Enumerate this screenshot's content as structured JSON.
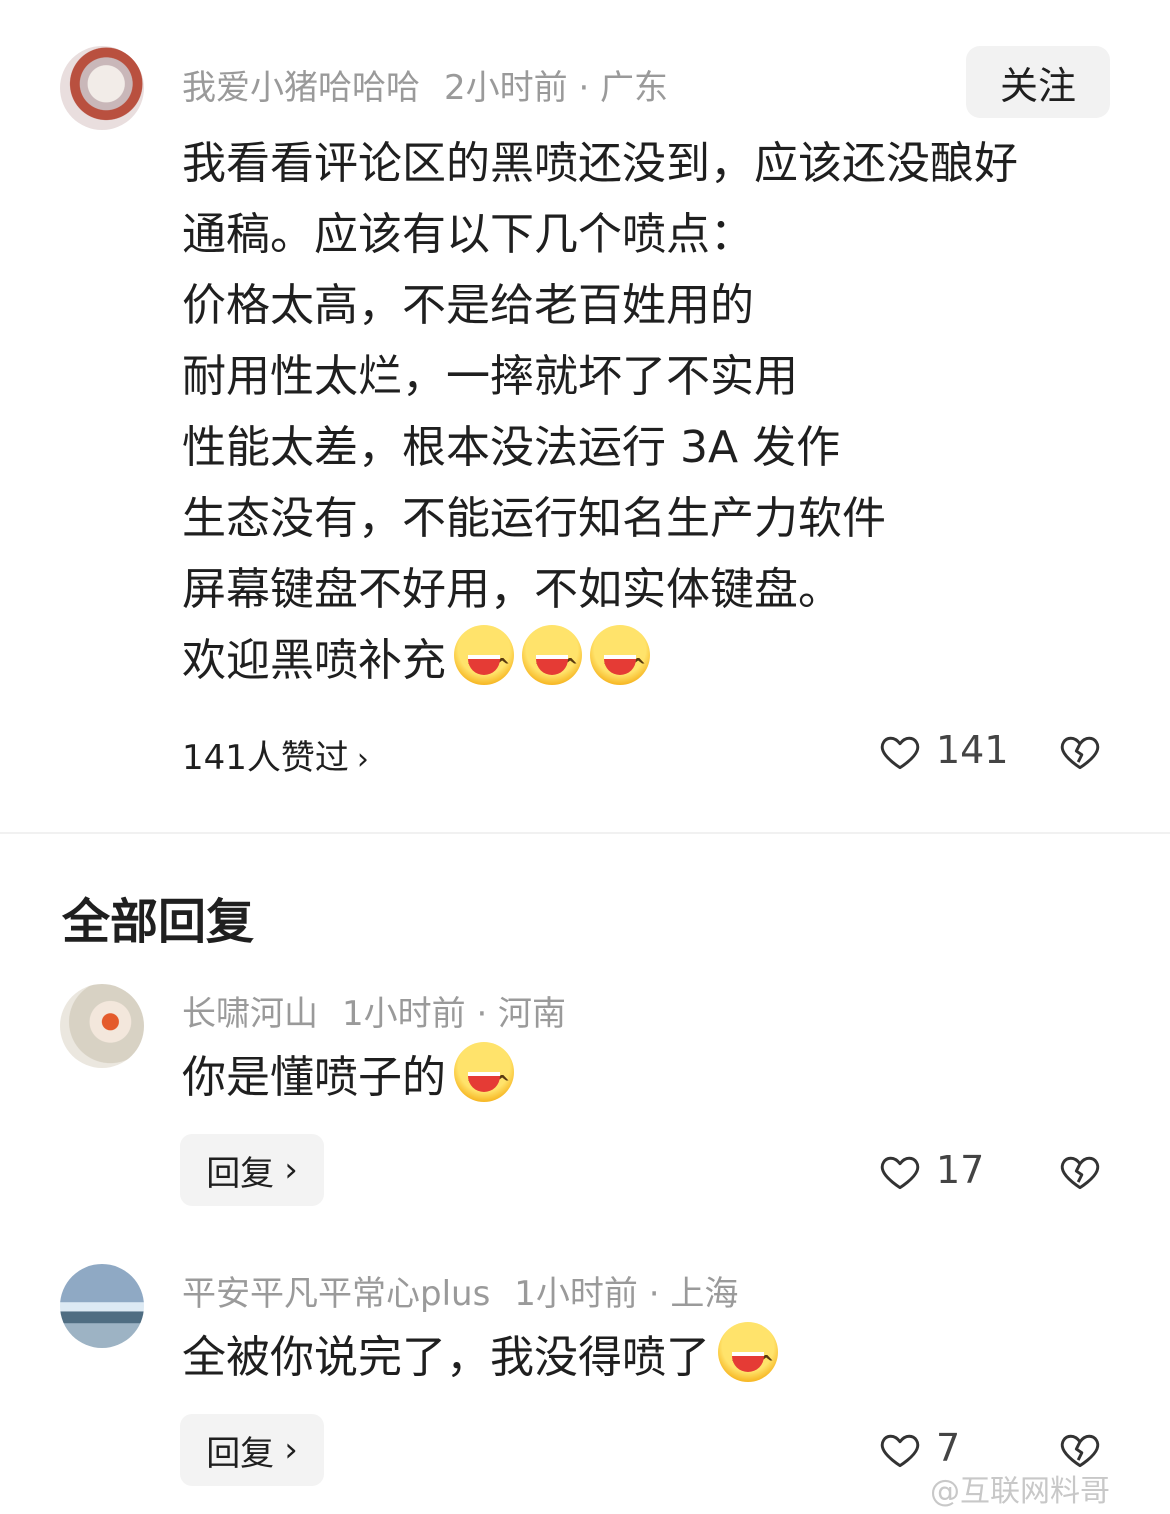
{
  "main_comment": {
    "username": "我爱小猪哈哈哈",
    "time_location": "2小时前 · 广东",
    "follow_label": "关注",
    "lines": [
      "我看看评论区的黑喷还没到，应该还没酿好",
      "通稿。应该有以下几个喷点：",
      "价格太高，不是给老百姓用的",
      "耐用性太烂，一摔就坏了不实用",
      "性能太差，根本没法运行 3A 发作",
      "生态没有，不能运行知名生产力软件",
      "屏幕键盘不好用，不如实体键盘。",
      "欢迎黑喷补充"
    ],
    "likers_summary": "141人赞过",
    "like_count": "141"
  },
  "section_title": "全部回复",
  "replies": [
    {
      "username": "长啸河山",
      "time_location": "1小时前 · 河南",
      "text": "你是懂喷子的",
      "reply_label": "回复",
      "like_count": "17"
    },
    {
      "username": "平安平凡平常心plus",
      "time_location": "1小时前 · 上海",
      "text": "全被你说完了，我没得喷了",
      "reply_label": "回复",
      "like_count": "7"
    }
  ],
  "watermark": "@互联网料哥",
  "icons": {
    "like": "heart-outline-icon",
    "dislike": "broken-heart-icon",
    "chevron": "chevron-right-icon",
    "emoji": "grinning-squint-emoji"
  },
  "colors": {
    "text": "#1f1f1f",
    "meta": "#9a9a9a",
    "button_bg": "#f2f2f2",
    "emoji": "#ffd447"
  }
}
